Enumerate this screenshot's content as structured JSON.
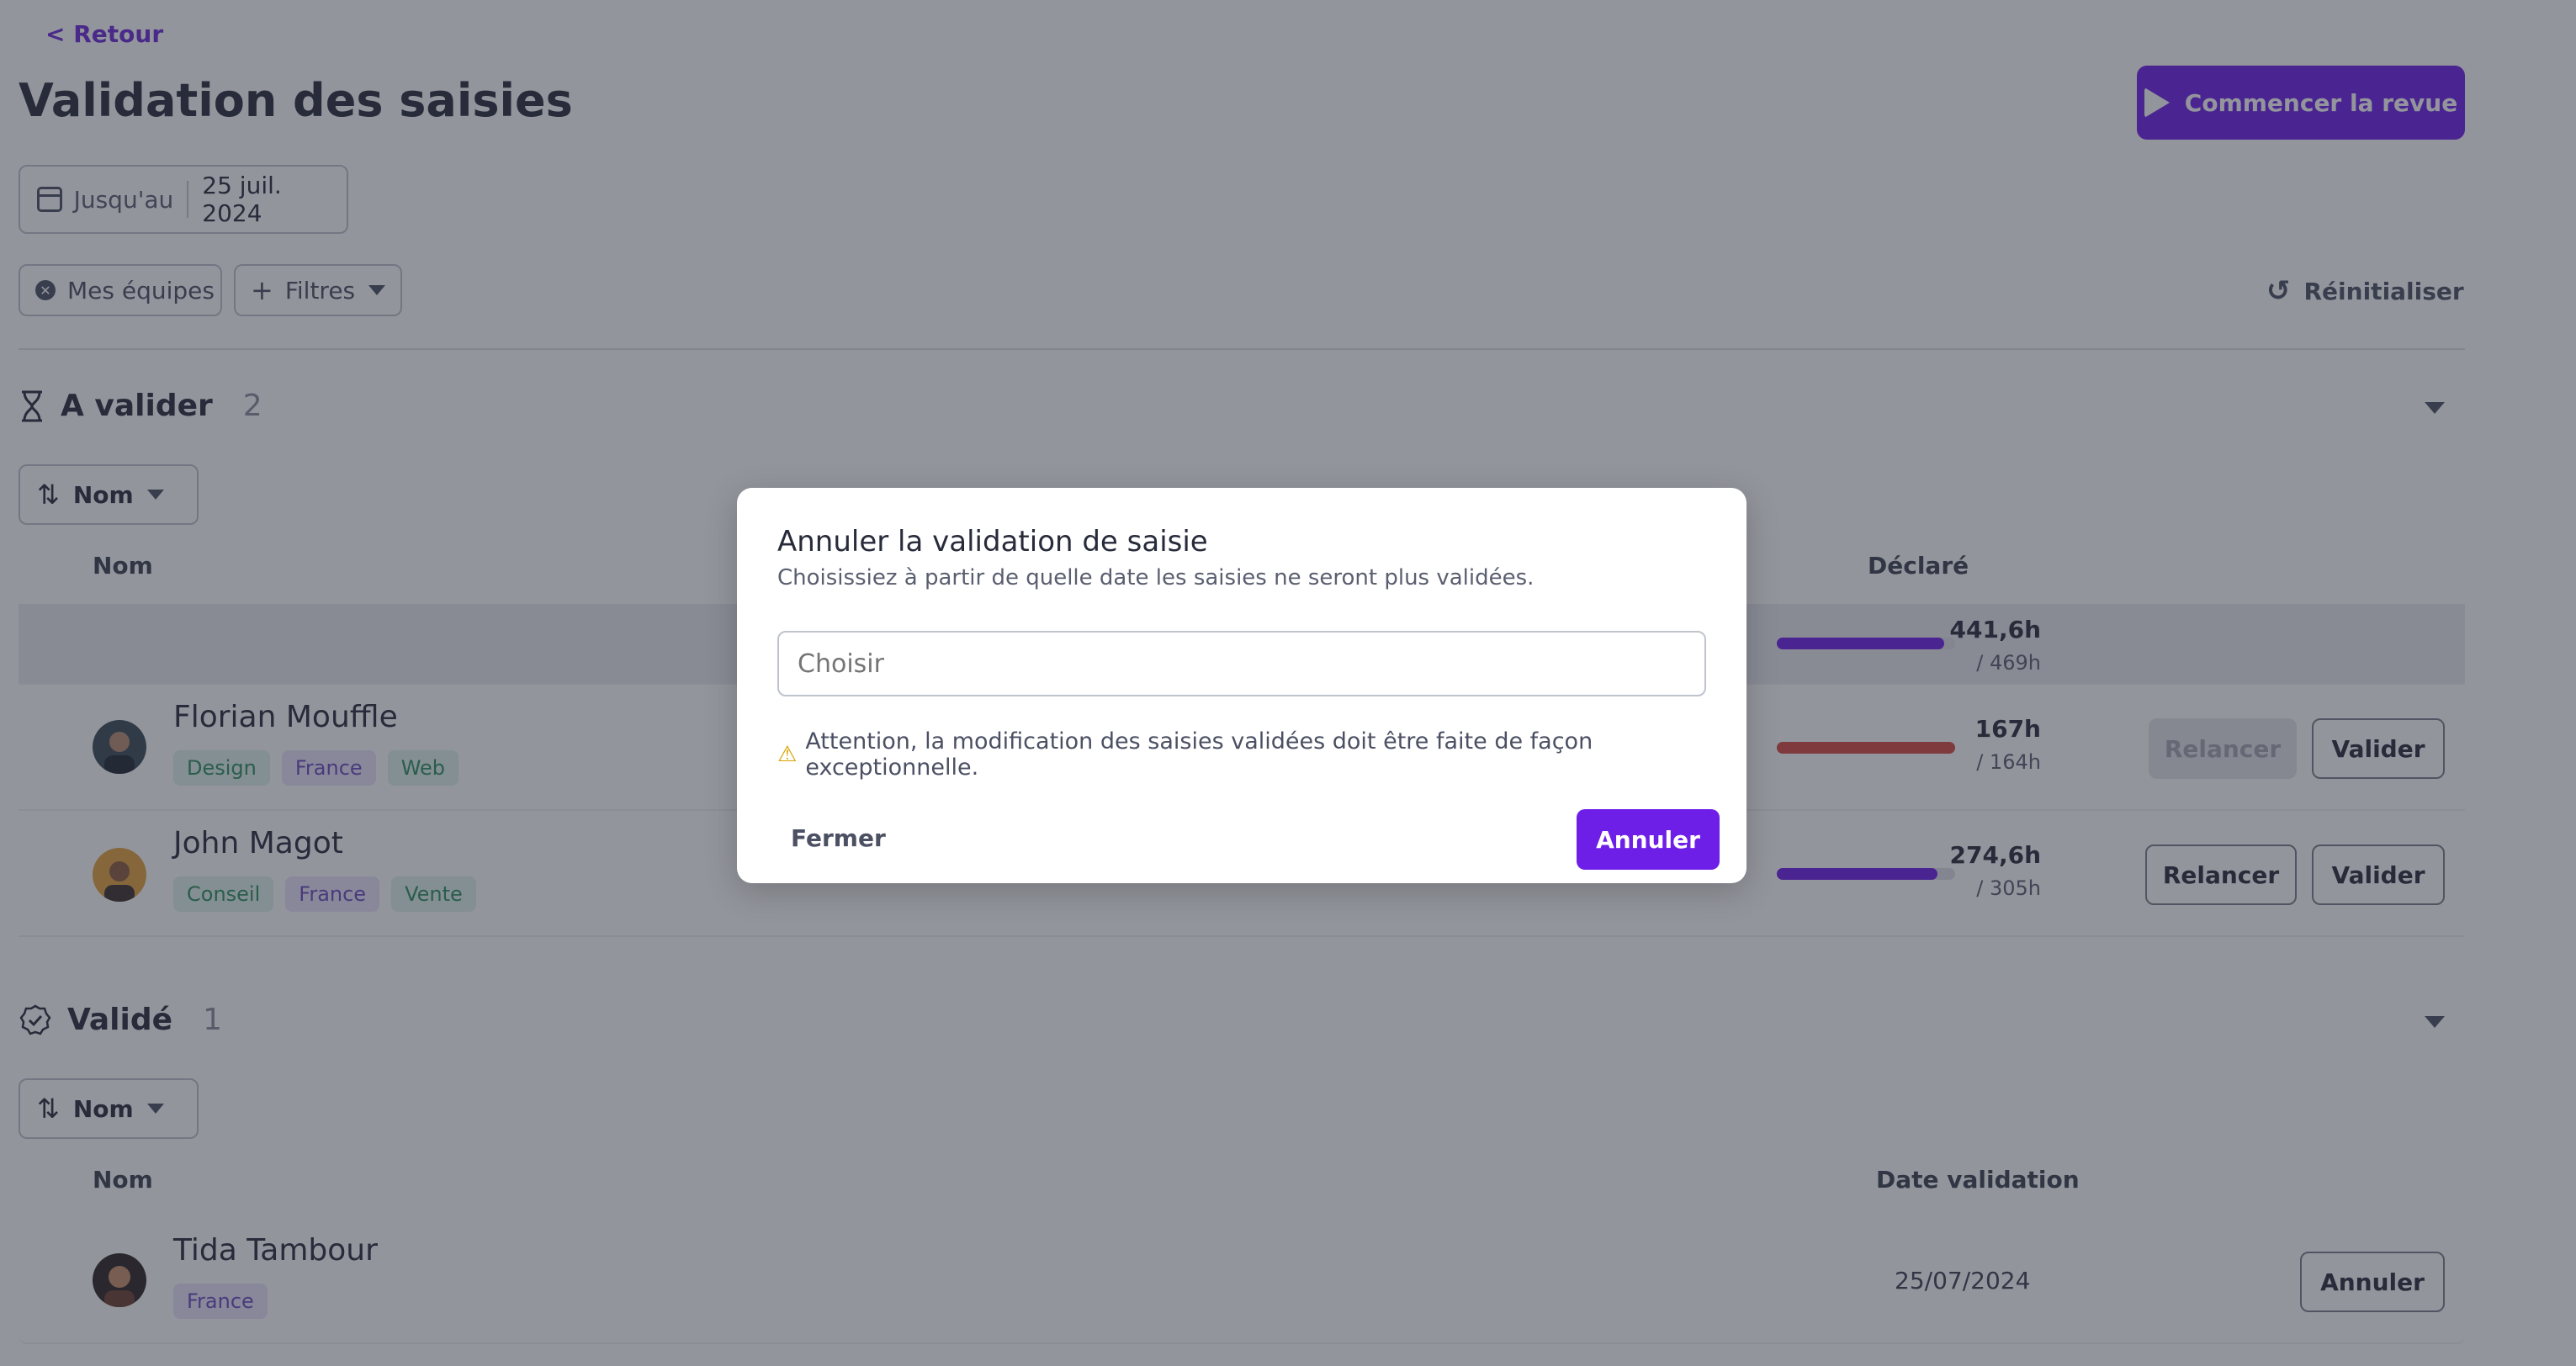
{
  "nav": {
    "back_label": "< Retour"
  },
  "page": {
    "title": "Validation des saisies",
    "start_review_label": "Commencer la revue"
  },
  "date_filter": {
    "prefix": "Jusqu'au",
    "value": "25 juil. 2024"
  },
  "filters": {
    "teams_label": "Mes équipes",
    "filters_label": "Filtres",
    "reset_label": "Réinitialiser"
  },
  "pending": {
    "title": "A valider",
    "count": "2",
    "sort_label": "Nom",
    "columns": {
      "name": "Nom",
      "declared": "Déclaré"
    },
    "total": {
      "hours": "441,6h",
      "target": "/ 469h",
      "progress": 0.94
    },
    "rows": [
      {
        "name": "Florian Mouffle",
        "tags": [
          "Design",
          "France",
          "Web"
        ],
        "hours": "167h",
        "target": "/ 164h",
        "progress": 1.0,
        "remind_label": "Relancer",
        "remind_disabled": true,
        "validate_label": "Valider"
      },
      {
        "name": "John Magot",
        "tags": [
          "Conseil",
          "France",
          "Vente"
        ],
        "hours": "274,6h",
        "target": "/ 305h",
        "progress": 0.9,
        "remind_label": "Relancer",
        "remind_disabled": false,
        "validate_label": "Valider"
      }
    ]
  },
  "validated": {
    "title": "Validé",
    "count": "1",
    "sort_label": "Nom",
    "columns": {
      "name": "Nom",
      "date": "Date validation"
    },
    "rows": [
      {
        "name": "Tida Tambour",
        "tags": [
          "France"
        ],
        "date": "25/07/2024",
        "cancel_label": "Annuler"
      }
    ]
  },
  "modal": {
    "title": "Annuler la validation de saisie",
    "subtitle": "Choisissiez à partir de quelle date les saisies ne seront plus validées.",
    "input_placeholder": "Choisir",
    "warning": "Attention, la modification des saisies validées doit être faite de façon exceptionnelle.",
    "close_label": "Fermer",
    "confirm_label": "Annuler"
  },
  "colors": {
    "accent": "#6d1fe8",
    "progress_ok": "#6d1fe8",
    "progress_over": "#d4493f",
    "tag_green_bg": "#dff3ea",
    "tag_purple_bg": "#ebe3fb"
  },
  "icons": {
    "calendar": "calendar-icon",
    "play": "play-icon",
    "reset": "reset-icon",
    "hourglass": "hourglass-icon",
    "check": "check-circle-icon",
    "sort": "sort-ascending-icon",
    "warning": "warning-icon"
  }
}
